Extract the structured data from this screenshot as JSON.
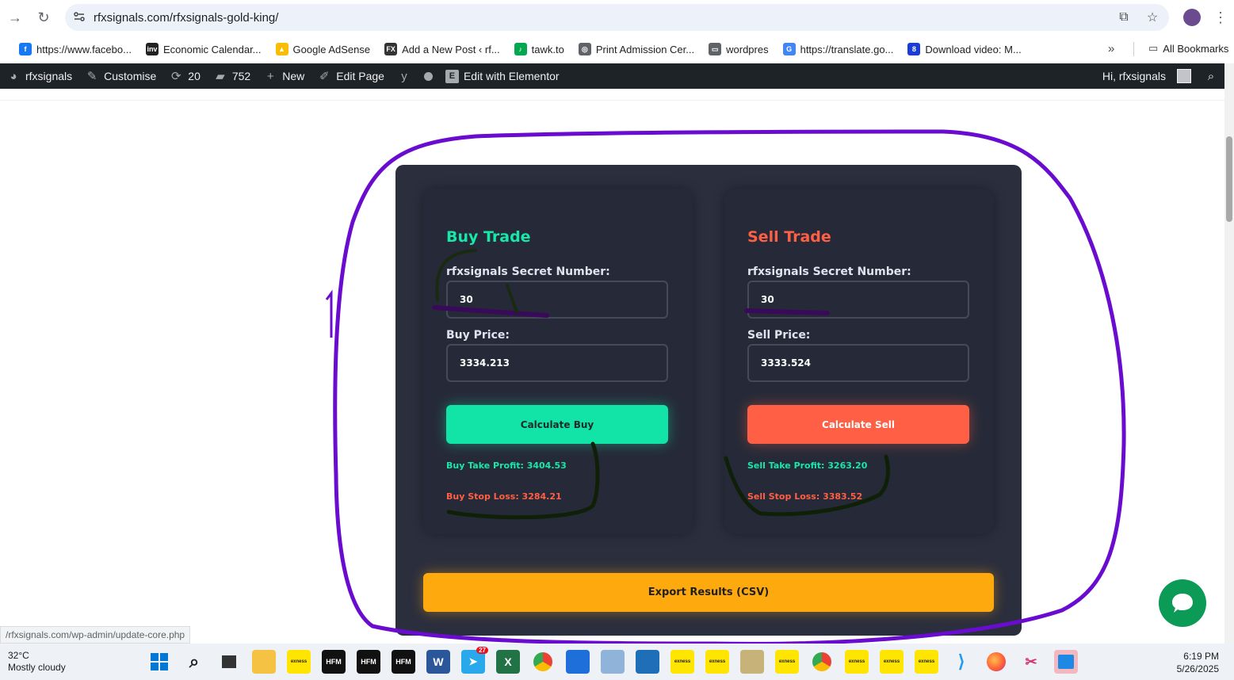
{
  "browser": {
    "url": "rfxsignals.com/rfxsignals-gold-king/",
    "bookmarks": [
      {
        "label": "https://www.facebo...",
        "icon": "facebook-icon",
        "color": "#1877f2",
        "glyph": "f"
      },
      {
        "label": "Economic Calendar...",
        "icon": "investing-icon",
        "color": "#222222",
        "glyph": "inv"
      },
      {
        "label": "Google AdSense",
        "icon": "adsense-icon",
        "color": "#fbbc04",
        "glyph": "▲"
      },
      {
        "label": "Add a New Post ‹ rf...",
        "icon": "forex-signal-icon",
        "color": "#333333",
        "glyph": "FX"
      },
      {
        "label": "tawk.to",
        "icon": "tawk-icon",
        "color": "#03a84e",
        "glyph": "♪"
      },
      {
        "label": "Print Admission Cer...",
        "icon": "globe-icon",
        "color": "#5f6368",
        "glyph": "◎"
      },
      {
        "label": "wordpres",
        "icon": "folder-icon",
        "color": "#5f6368",
        "glyph": "▭"
      },
      {
        "label": "https://translate.go...",
        "icon": "translate-icon",
        "color": "#4285f4",
        "glyph": "G"
      },
      {
        "label": "Download video: M...",
        "icon": "download-icon",
        "color": "#1a3dd6",
        "glyph": "8"
      }
    ],
    "all_bookmarks": "All Bookmarks",
    "status_url": "/rfxsignals.com/wp-admin/update-core.php"
  },
  "wpbar": {
    "site": "rfxsignals",
    "customise": "Customise",
    "updates": "20",
    "comments": "752",
    "new": "New",
    "edit_page": "Edit Page",
    "elementor": "Edit with Elementor",
    "greeting": "Hi, rfxsignals"
  },
  "buy": {
    "title": "Buy Trade",
    "secret_label": "rfxsignals Secret Number:",
    "secret_value": "30",
    "price_label": "Buy Price:",
    "price_value": "3334.213",
    "button": "Calculate Buy",
    "take_profit": "Buy Take Profit: 3404.53",
    "stop_loss": "Buy Stop Loss: 3284.21"
  },
  "sell": {
    "title": "Sell Trade",
    "secret_label": "rfxsignals Secret Number:",
    "secret_value": "30",
    "price_label": "Sell Price:",
    "price_value": "3333.524",
    "button": "Calculate Sell",
    "take_profit": "Sell Take Profit: 3263.20",
    "stop_loss": "Sell Stop Loss: 3383.52"
  },
  "export_button": "Export Results (CSV)",
  "taskbar": {
    "temperature": "32°C",
    "weather": "Mostly cloudy",
    "time": "6:19 PM",
    "date": "5/26/2025",
    "telegram_badge": "27",
    "exness": "exness",
    "hfm": "HFM"
  },
  "colors": {
    "buy_accent": "#17e8a8",
    "sell_accent": "#ff5f43",
    "export_accent": "#fea90e",
    "panel": "#2b2e3d",
    "annotation_purple": "#6a0ccf"
  }
}
